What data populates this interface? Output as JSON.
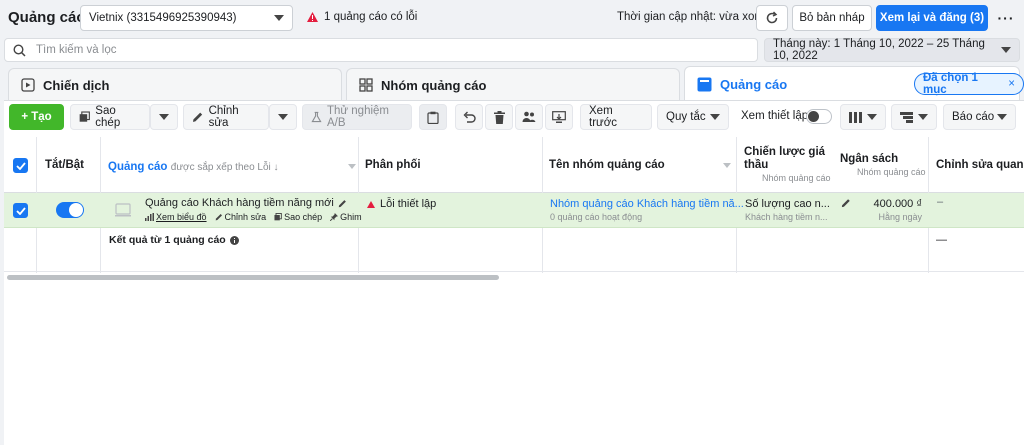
{
  "header": {
    "title": "Quảng cáo",
    "account": "Vietnix (3315496925390943)",
    "error_text": "1 quảng cáo có lỗi",
    "updated_text": "Thời gian cập nhật: vừa xong",
    "discard_label": "Bỏ bản nháp",
    "publish_label": "Xem lại và đăng (3)",
    "more_label": "···"
  },
  "search": {
    "placeholder": "Tìm kiếm và lọc",
    "date_range": "Tháng này: 1 Tháng 10, 2022 – 25 Tháng 10, 2022"
  },
  "tabs": [
    {
      "label": "Chiến dịch"
    },
    {
      "label": "Nhóm quảng cáo"
    },
    {
      "label": "Quảng cáo"
    }
  ],
  "selected_pill": {
    "label": "Đã chọn 1 mục",
    "close": "×"
  },
  "toolbar": {
    "create_label": "+ Tạo",
    "copy_label": "Sao chép",
    "edit_label": "Chỉnh sửa",
    "ab_test_label": "Thử nghiệm A/B",
    "preview_label": "Xem trước",
    "rules_label": "Quy tắc",
    "setup_label": "Xem thiết lập",
    "report_label": "Báo cáo"
  },
  "table": {
    "headers": {
      "toggle": "Tắt/Bật",
      "ad": "Quảng cáo",
      "ad_sort": "được sắp xếp theo Lỗi ↓",
      "delivery": "Phân phối",
      "adset": "Tên nhóm quảng cáo",
      "bid": "Chiến lược giá thầu",
      "bid_sub": "Nhóm quảng cáo",
      "budget": "Ngân sách",
      "budget_sub": "Nhóm quảng cáo",
      "key_edits": "Chỉnh sửa quan trọng"
    },
    "row": {
      "ad_name": "Quảng cáo Khách hàng tiềm năng mới",
      "action_chart": "Xem biểu đồ",
      "action_edit": "Chỉnh sửa",
      "action_copy": "Sao chép",
      "action_pin": "Ghim",
      "delivery": "Lỗi thiết lập",
      "adset": "Nhóm quảng cáo Khách hàng tiềm nă...",
      "adset_sub": "0 quảng cáo hoạt động",
      "bid": "Số lượng cao n...",
      "bid_sub": "Khách hàng tiềm n...",
      "budget": "400.000 ₫",
      "budget_sub": "Hằng ngày",
      "key_edits": "–"
    },
    "summary": {
      "label": "Kết quả từ 1 quảng cáo",
      "key_edits": "—"
    }
  },
  "colors": {
    "primary": "#1877f2",
    "create": "#42b72a",
    "error": "#e41e3f",
    "selected_row": "#e3f3dd"
  }
}
